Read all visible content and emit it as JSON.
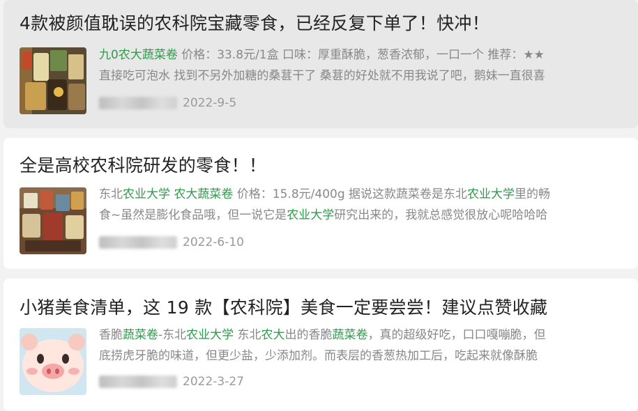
{
  "results": [
    {
      "title": "4款被颜值耽误的农科院宝藏零食，已经反复下单了！快冲！",
      "line1": [
        {
          "text": "九0农大蔬菜卷",
          "hl": true
        },
        {
          "text": " 价格：33.8元/1盒 口味：厚重酥脆，葱香浓郁，一口一个 推荐：★★",
          "hl": false
        }
      ],
      "line2": [
        {
          "text": "直接吃可泡水 找到不另外加糖的桑葚干了 桑葚的好处就不用我说了吧，鹅妹一直很喜",
          "hl": false
        }
      ],
      "date": "2022-9-5",
      "thumb_colors": [
        "#8a6a3a",
        "#c24a2a",
        "#e6d9a8",
        "#6d8a4a",
        "#3a2a1a"
      ]
    },
    {
      "title": "全是高校农科院研发的零食！！",
      "line1": [
        {
          "text": "东北",
          "hl": false
        },
        {
          "text": "农业大学",
          "hl": true
        },
        {
          "text": " ",
          "hl": false
        },
        {
          "text": "农大蔬菜卷",
          "hl": true
        },
        {
          "text": " 价格：15.8元/400g 据说这款蔬菜卷是东北",
          "hl": false
        },
        {
          "text": "农业大学",
          "hl": true
        },
        {
          "text": "里的畅",
          "hl": false
        }
      ],
      "line2": [
        {
          "text": "食~虽然是膨化食品哦，但一说它是",
          "hl": false
        },
        {
          "text": "农业大学",
          "hl": true
        },
        {
          "text": "研究出来的，我就总感觉很放心呢哈哈哈",
          "hl": false
        }
      ],
      "date": "2022-6-10",
      "thumb_colors": [
        "#7a5a3a",
        "#d0a050",
        "#6a8aa0",
        "#c05a3a",
        "#e8e0c8"
      ]
    },
    {
      "title": "小猪美食清单，这 19 款【农科院】美食一定要尝尝！建议点赞收藏",
      "line1": [
        {
          "text": "香脆",
          "hl": false
        },
        {
          "text": "蔬菜卷",
          "hl": true
        },
        {
          "text": "-东北",
          "hl": false
        },
        {
          "text": "农业大学",
          "hl": true
        },
        {
          "text": " 东北",
          "hl": false
        },
        {
          "text": "农大",
          "hl": true
        },
        {
          "text": "出的香脆",
          "hl": false
        },
        {
          "text": "蔬菜卷",
          "hl": true
        },
        {
          "text": "，真的超级好吃，口口嘎嘣脆，但",
          "hl": false
        }
      ],
      "line2": [
        {
          "text": "底捞虎牙脆的味道，但更少盐，少添加剂。而表层的香葱热加工后，吃起来就像酥脆",
          "hl": false
        }
      ],
      "date": "2022-3-27",
      "thumb_colors": [
        "#f7c9c0",
        "#ffe6df",
        "#e88a8a",
        "#3a2a2a",
        "#d0e6f0"
      ]
    }
  ]
}
